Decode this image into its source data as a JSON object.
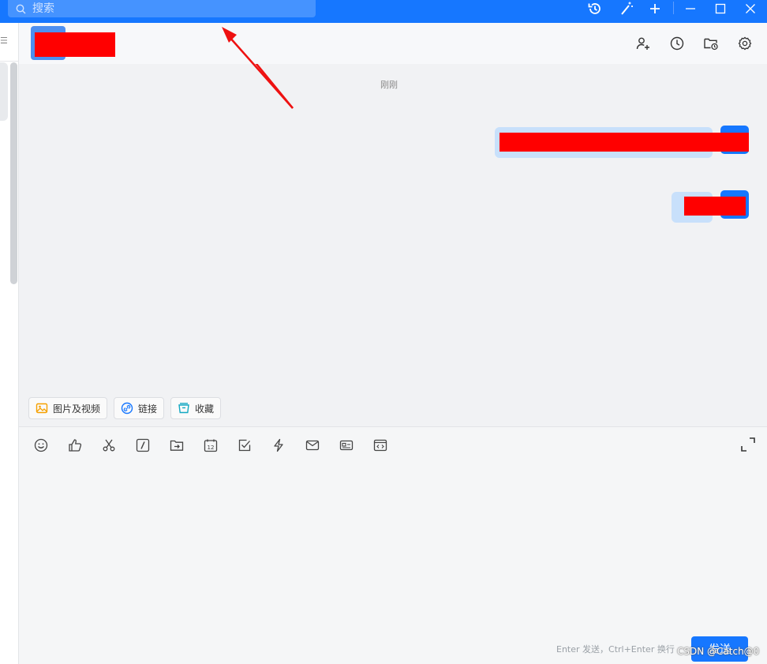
{
  "titlebar": {
    "search_placeholder": "搜索",
    "icons": [
      "history-icon",
      "magic-wand-icon",
      "plus-icon",
      "minimize-icon",
      "maximize-icon",
      "close-icon"
    ],
    "color": "#1677ff"
  },
  "left_panel": {
    "menu_glyph": "☰"
  },
  "chat_header": {
    "icons": [
      "add-member-icon",
      "clock-icon",
      "folder-history-icon",
      "settings-icon"
    ]
  },
  "messages": {
    "timestamp": "刚刚"
  },
  "quick_actions": [
    {
      "label": "图片及视频",
      "icon": "image-icon"
    },
    {
      "label": "链接",
      "icon": "link-icon"
    },
    {
      "label": "收藏",
      "icon": "favorite-box-icon"
    }
  ],
  "composer": {
    "tools": [
      "emoji-icon",
      "thumbs-up-icon",
      "scissors-icon",
      "slash-command-icon",
      "folder-send-icon",
      "calendar-icon",
      "checkbox-icon",
      "lightning-icon",
      "mail-icon",
      "card-icon",
      "code-window-icon"
    ],
    "calendar_number": "12",
    "hint": "Enter 发送，Ctrl+Enter 换行",
    "send_label": "发送"
  },
  "watermark": "CSDN @Catch@0",
  "colors": {
    "accent": "#1677ff",
    "bubble": "#c8e0fb",
    "annotation": "#ff0000"
  }
}
